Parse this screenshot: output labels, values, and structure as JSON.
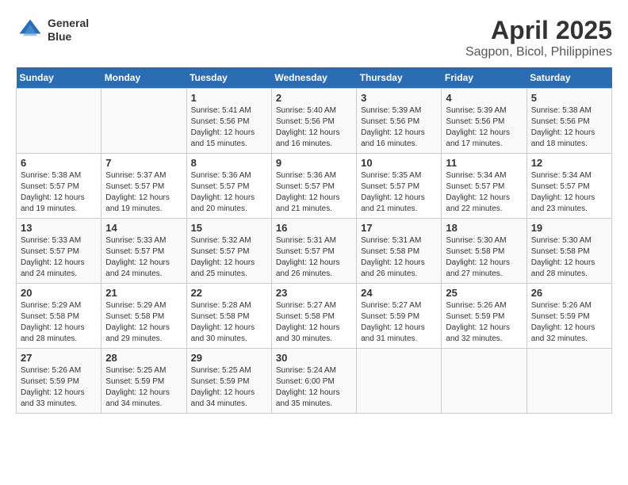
{
  "header": {
    "logo_line1": "General",
    "logo_line2": "Blue",
    "title": "April 2025",
    "subtitle": "Sagpon, Bicol, Philippines"
  },
  "weekdays": [
    "Sunday",
    "Monday",
    "Tuesday",
    "Wednesday",
    "Thursday",
    "Friday",
    "Saturday"
  ],
  "weeks": [
    [
      {
        "day": "",
        "info": ""
      },
      {
        "day": "",
        "info": ""
      },
      {
        "day": "1",
        "info": "Sunrise: 5:41 AM\nSunset: 5:56 PM\nDaylight: 12 hours and 15 minutes."
      },
      {
        "day": "2",
        "info": "Sunrise: 5:40 AM\nSunset: 5:56 PM\nDaylight: 12 hours and 16 minutes."
      },
      {
        "day": "3",
        "info": "Sunrise: 5:39 AM\nSunset: 5:56 PM\nDaylight: 12 hours and 16 minutes."
      },
      {
        "day": "4",
        "info": "Sunrise: 5:39 AM\nSunset: 5:56 PM\nDaylight: 12 hours and 17 minutes."
      },
      {
        "day": "5",
        "info": "Sunrise: 5:38 AM\nSunset: 5:56 PM\nDaylight: 12 hours and 18 minutes."
      }
    ],
    [
      {
        "day": "6",
        "info": "Sunrise: 5:38 AM\nSunset: 5:57 PM\nDaylight: 12 hours and 19 minutes."
      },
      {
        "day": "7",
        "info": "Sunrise: 5:37 AM\nSunset: 5:57 PM\nDaylight: 12 hours and 19 minutes."
      },
      {
        "day": "8",
        "info": "Sunrise: 5:36 AM\nSunset: 5:57 PM\nDaylight: 12 hours and 20 minutes."
      },
      {
        "day": "9",
        "info": "Sunrise: 5:36 AM\nSunset: 5:57 PM\nDaylight: 12 hours and 21 minutes."
      },
      {
        "day": "10",
        "info": "Sunrise: 5:35 AM\nSunset: 5:57 PM\nDaylight: 12 hours and 21 minutes."
      },
      {
        "day": "11",
        "info": "Sunrise: 5:34 AM\nSunset: 5:57 PM\nDaylight: 12 hours and 22 minutes."
      },
      {
        "day": "12",
        "info": "Sunrise: 5:34 AM\nSunset: 5:57 PM\nDaylight: 12 hours and 23 minutes."
      }
    ],
    [
      {
        "day": "13",
        "info": "Sunrise: 5:33 AM\nSunset: 5:57 PM\nDaylight: 12 hours and 24 minutes."
      },
      {
        "day": "14",
        "info": "Sunrise: 5:33 AM\nSunset: 5:57 PM\nDaylight: 12 hours and 24 minutes."
      },
      {
        "day": "15",
        "info": "Sunrise: 5:32 AM\nSunset: 5:57 PM\nDaylight: 12 hours and 25 minutes."
      },
      {
        "day": "16",
        "info": "Sunrise: 5:31 AM\nSunset: 5:57 PM\nDaylight: 12 hours and 26 minutes."
      },
      {
        "day": "17",
        "info": "Sunrise: 5:31 AM\nSunset: 5:58 PM\nDaylight: 12 hours and 26 minutes."
      },
      {
        "day": "18",
        "info": "Sunrise: 5:30 AM\nSunset: 5:58 PM\nDaylight: 12 hours and 27 minutes."
      },
      {
        "day": "19",
        "info": "Sunrise: 5:30 AM\nSunset: 5:58 PM\nDaylight: 12 hours and 28 minutes."
      }
    ],
    [
      {
        "day": "20",
        "info": "Sunrise: 5:29 AM\nSunset: 5:58 PM\nDaylight: 12 hours and 28 minutes."
      },
      {
        "day": "21",
        "info": "Sunrise: 5:29 AM\nSunset: 5:58 PM\nDaylight: 12 hours and 29 minutes."
      },
      {
        "day": "22",
        "info": "Sunrise: 5:28 AM\nSunset: 5:58 PM\nDaylight: 12 hours and 30 minutes."
      },
      {
        "day": "23",
        "info": "Sunrise: 5:27 AM\nSunset: 5:58 PM\nDaylight: 12 hours and 30 minutes."
      },
      {
        "day": "24",
        "info": "Sunrise: 5:27 AM\nSunset: 5:59 PM\nDaylight: 12 hours and 31 minutes."
      },
      {
        "day": "25",
        "info": "Sunrise: 5:26 AM\nSunset: 5:59 PM\nDaylight: 12 hours and 32 minutes."
      },
      {
        "day": "26",
        "info": "Sunrise: 5:26 AM\nSunset: 5:59 PM\nDaylight: 12 hours and 32 minutes."
      }
    ],
    [
      {
        "day": "27",
        "info": "Sunrise: 5:26 AM\nSunset: 5:59 PM\nDaylight: 12 hours and 33 minutes."
      },
      {
        "day": "28",
        "info": "Sunrise: 5:25 AM\nSunset: 5:59 PM\nDaylight: 12 hours and 34 minutes."
      },
      {
        "day": "29",
        "info": "Sunrise: 5:25 AM\nSunset: 5:59 PM\nDaylight: 12 hours and 34 minutes."
      },
      {
        "day": "30",
        "info": "Sunrise: 5:24 AM\nSunset: 6:00 PM\nDaylight: 12 hours and 35 minutes."
      },
      {
        "day": "",
        "info": ""
      },
      {
        "day": "",
        "info": ""
      },
      {
        "day": "",
        "info": ""
      }
    ]
  ]
}
